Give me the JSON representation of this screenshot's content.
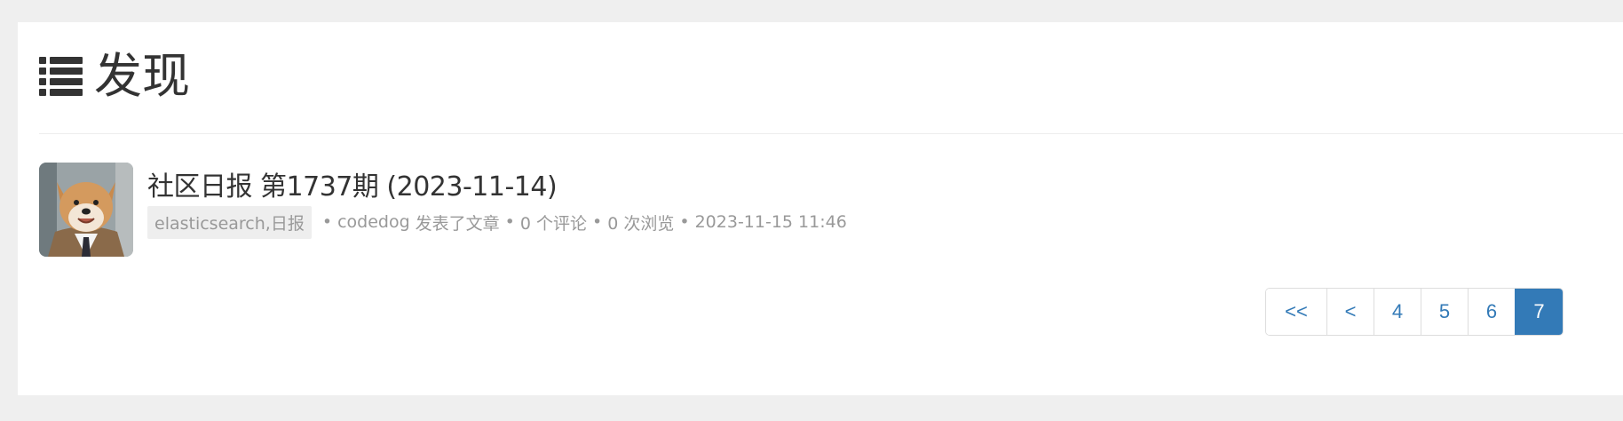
{
  "header": {
    "title": "发现",
    "icon": "list-icon"
  },
  "article": {
    "title": "社区日报 第1737期 (2023-11-14)",
    "tags": "elasticsearch,日报",
    "author": "codedog",
    "action": "发表了文章",
    "comments": "0 个评论",
    "views": "0 次浏览",
    "datetime": "2023-11-15 11:46",
    "separator": "•",
    "avatar_icon": "shiba-dog-avatar"
  },
  "pagination": {
    "first": "<<",
    "prev": "<",
    "pages": [
      "4",
      "5",
      "6",
      "7"
    ],
    "current": "7"
  },
  "colors": {
    "background": "#efefef",
    "panel": "#ffffff",
    "text": "#333333",
    "muted": "#999999",
    "link": "#337ab7",
    "active_page": "#337ab7"
  }
}
